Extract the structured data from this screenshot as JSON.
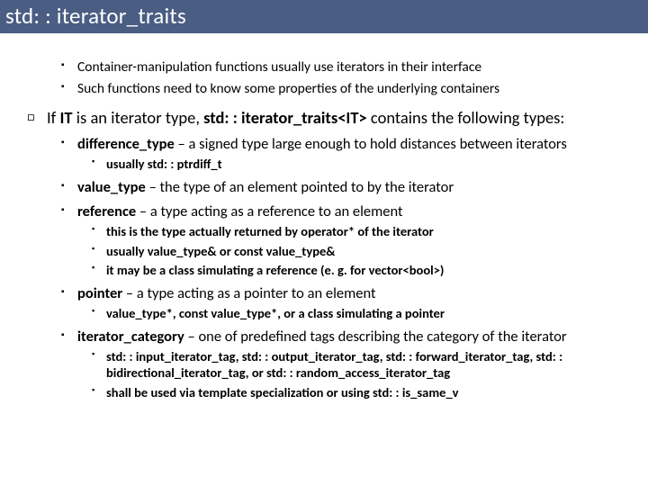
{
  "title": "std: : iterator_traits",
  "intro": [
    "Container-manipulation functions usually use iterators in their interface",
    "Such functions need to know some properties of the underlying containers"
  ],
  "main": {
    "prefix": "If ",
    "bold1": "IT",
    "mid": " is an iterator type, ",
    "bold2": "std: : iterator_traits<IT>",
    "suffix": " contains the following types:"
  },
  "types": {
    "diff": {
      "name": "difference_type",
      "desc": " – a signed type large enough to hold distances between iterators",
      "sub": [
        "usually std: : ptrdiff_t"
      ]
    },
    "value": {
      "name": "value_type",
      "desc": " – the type of an element pointed to by the iterator"
    },
    "reference": {
      "name": "reference",
      "desc": " – a type acting as a reference to an element",
      "sub": [
        "this is the type actually returned by operator* of the iterator",
        "usually value_type& or const value_type&",
        "it may be a class simulating a reference (e. g. for vector<bool>)"
      ]
    },
    "pointer": {
      "name": "pointer",
      "desc": " – a type acting as a pointer to an element",
      "sub": [
        "value_type*, const value_type*, or a class simulating a pointer"
      ]
    },
    "category": {
      "name": "iterator_category",
      "desc": " – one of predefined tags describing the category of the iterator",
      "sub": [
        "std: : input_iterator_tag, std: : output_iterator_tag, std: : forward_iterator_tag, std: : bidirectional_iterator_tag, or std: : random_access_iterator_tag",
        "shall be used via template specialization or using std: : is_same_v"
      ]
    }
  }
}
